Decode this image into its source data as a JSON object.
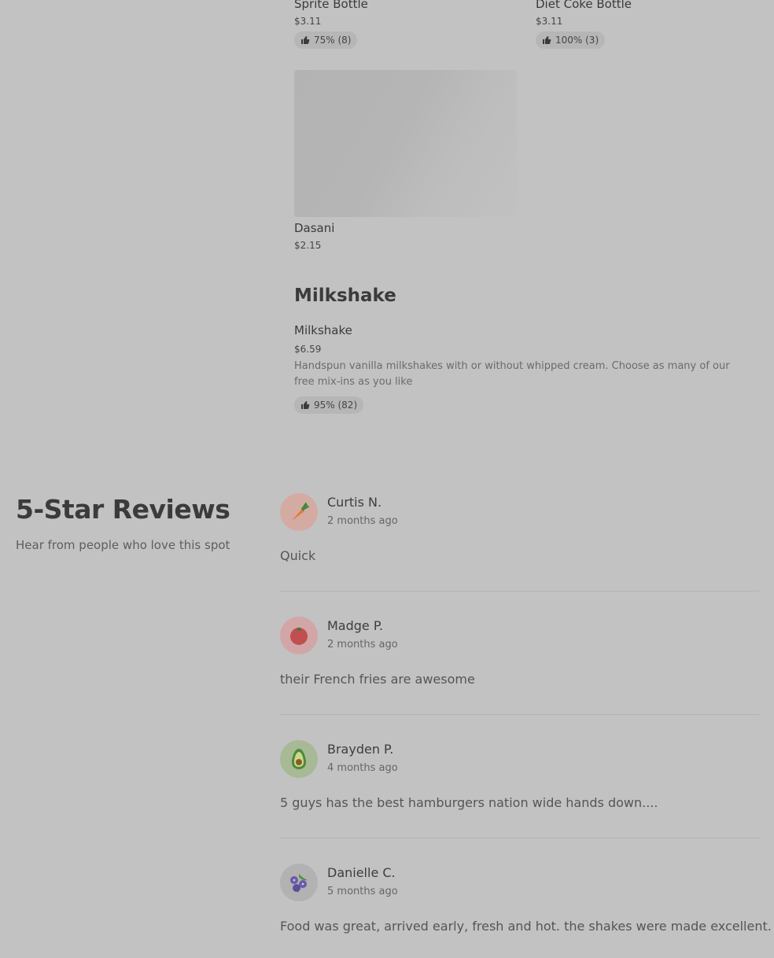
{
  "menu": {
    "drinks": [
      {
        "name": "Sprite Bottle",
        "price": "$3.11",
        "rating": "75% (8)"
      },
      {
        "name": "Diet Coke Bottle",
        "price": "$3.11",
        "rating": "100% (3)"
      },
      {
        "name": "Dasani",
        "price": "$2.15"
      }
    ],
    "milkshake_section": {
      "title": "Milkshake",
      "item": {
        "name": "Milkshake",
        "price": "$6.59",
        "description": "Handspun vanilla milkshakes with or without whipped cream. Choose as many of our free mix-ins as you like",
        "rating": "95% (82)"
      }
    }
  },
  "reviews": {
    "title": "5-Star Reviews",
    "subtitle": "Hear from people who love this spot",
    "items": [
      {
        "name": "Curtis N.",
        "time": "2 months ago",
        "text": "Quick",
        "avatar_icon": "carrot-icon",
        "avatar_bg": "#d4aba2"
      },
      {
        "name": "Madge P.",
        "time": "2 months ago",
        "text": "their French fries are awesome",
        "avatar_icon": "tomato-icon",
        "avatar_bg": "#d2a6a6"
      },
      {
        "name": "Brayden P.",
        "time": "4 months ago",
        "text": "5 guys has the best hamburgers nation wide hands down....",
        "avatar_icon": "avocado-icon",
        "avatar_bg": "#a7b995"
      },
      {
        "name": "Danielle C.",
        "time": "5 months ago",
        "text": "Food was great, arrived early, fresh and hot. the shakes were made excellent.",
        "avatar_icon": "blueberry-icon",
        "avatar_bg": "#b2b2b2"
      }
    ]
  }
}
